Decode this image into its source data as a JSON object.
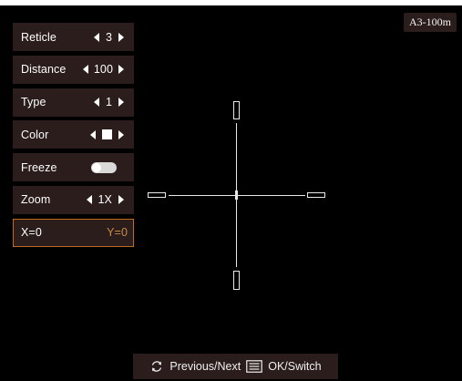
{
  "profile": {
    "badge": "A3-100m"
  },
  "menu": {
    "reticle": {
      "label": "Reticle",
      "value": "3"
    },
    "distance": {
      "label": "Distance",
      "value": "100"
    },
    "type": {
      "label": "Type",
      "value": "1"
    },
    "color": {
      "label": "Color",
      "value_color": "#ffffff"
    },
    "freeze": {
      "label": "Freeze",
      "enabled": false
    },
    "zoom": {
      "label": "Zoom",
      "value": "1X"
    },
    "coords": {
      "x_label": "X=0",
      "y_label": "Y=0"
    }
  },
  "hints": {
    "previous_next": "Previous/Next",
    "ok_switch": "OK/Switch",
    "icons": [
      "cycle-arrows-icon",
      "menu-list-icon"
    ]
  },
  "colors": {
    "panel": "#2a1d1c",
    "accent_orange": "#c26a1a",
    "y_value": "#c98b46",
    "reticle": "#e8e8e8"
  }
}
